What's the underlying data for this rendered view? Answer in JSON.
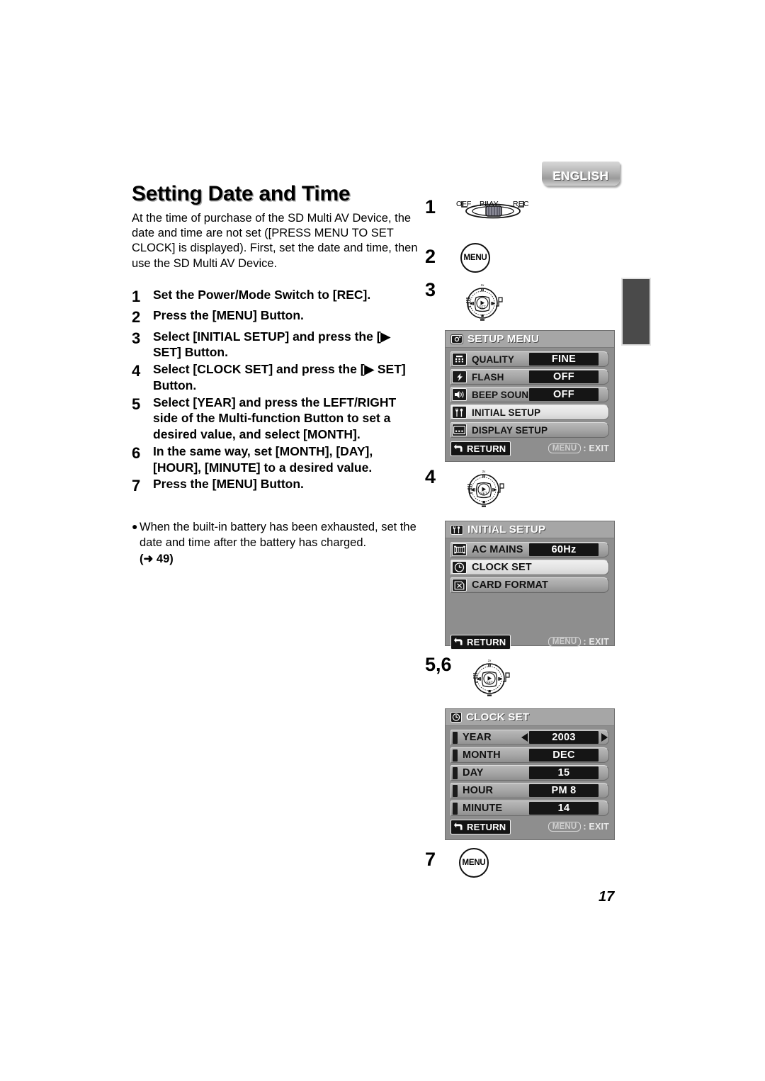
{
  "page": {
    "language_tab": "ENGLISH",
    "page_number": "17"
  },
  "article": {
    "title": "Setting Date and Time",
    "intro": "At the time of purchase of the SD Multi AV Device, the date and time are not set ([PRESS MENU TO SET CLOCK] is displayed). First, set the date and time, then use the SD Multi AV Device.",
    "steps": [
      {
        "num": "1",
        "text": "Set the Power/Mode Switch to [REC]."
      },
      {
        "num": "2",
        "text": "Press the [MENU] Button."
      },
      {
        "num": "3",
        "text": "Select [INITIAL SETUP] and press the [▶ SET] Button."
      },
      {
        "num": "4",
        "text": "Select [CLOCK SET] and press the [▶ SET] Button."
      },
      {
        "num": "5",
        "text": "Select [YEAR] and press the LEFT/RIGHT side of the Multi-function Button to set a desired value, and select [MONTH]."
      },
      {
        "num": "6",
        "text": "In the same way, set [MONTH], [DAY], [HOUR], [MINUTE] to a desired value."
      },
      {
        "num": "7",
        "text": "Press the [MENU] Button."
      }
    ],
    "note": {
      "bullet": "●",
      "text": "When the built-in battery has been exhausted, set the date and time after the battery has charged.",
      "reference": "(➜ 49)"
    }
  },
  "diagrams": {
    "step1": {
      "num": "1",
      "switch_labels": [
        "OFF",
        "PLAY",
        "REC"
      ]
    },
    "step2": {
      "num": "2",
      "button_label": "MENU"
    },
    "step3": {
      "num": "3",
      "dial_center": "SET",
      "dial_zoom": "2x"
    },
    "step4": {
      "num": "4",
      "dial_center": "SET",
      "dial_zoom": "2x"
    },
    "step56": {
      "num": "5,6",
      "dial_center": "SET",
      "dial_zoom": "2x"
    },
    "step7": {
      "num": "7",
      "button_label": "MENU"
    }
  },
  "osd_setup_menu": {
    "title": "SETUP MENU",
    "title_icon": "camera-icon",
    "rows": [
      {
        "icon": "quality-grid-icon",
        "label": "QUALITY",
        "value": "FINE",
        "highlighted": false
      },
      {
        "icon": "flash-bolt-icon",
        "label": "FLASH",
        "value": "OFF",
        "highlighted": false
      },
      {
        "icon": "beep-speaker-icon",
        "label": "BEEP SOUND",
        "value": "OFF",
        "highlighted": false
      },
      {
        "icon": "tools-icon",
        "label": "INITIAL SETUP",
        "value": "",
        "highlighted": true
      },
      {
        "icon": "display-icon",
        "label": "DISPLAY SETUP",
        "value": "",
        "highlighted": false
      }
    ],
    "return_label": "RETURN",
    "exit_key": "MENU",
    "exit_text": ": EXIT"
  },
  "osd_initial_setup": {
    "title": "INITIAL SETUP",
    "title_icon": "tools-icon",
    "rows": [
      {
        "icon": "ac-mains-icon",
        "label": "AC MAINS",
        "value": "60Hz",
        "highlighted": false
      },
      {
        "icon": "clock-icon",
        "label": "CLOCK SET",
        "value": "",
        "highlighted": true
      },
      {
        "icon": "card-format-icon",
        "label": "CARD FORMAT",
        "value": "",
        "highlighted": false
      }
    ],
    "return_label": "RETURN",
    "exit_key": "MENU",
    "exit_text": ": EXIT"
  },
  "osd_clock_set": {
    "title": "CLOCK SET",
    "title_icon": "clock-icon",
    "rows": [
      {
        "label": "YEAR",
        "value": "2003",
        "arrows": true
      },
      {
        "label": "MONTH",
        "value": "DEC",
        "arrows": false
      },
      {
        "label": "DAY",
        "value": "15",
        "arrows": false
      },
      {
        "label": "HOUR",
        "value": "PM 8",
        "arrows": false
      },
      {
        "label": "MINUTE",
        "value": "14",
        "arrows": false
      }
    ],
    "return_label": "RETURN",
    "exit_key": "MENU",
    "exit_text": ": EXIT"
  }
}
